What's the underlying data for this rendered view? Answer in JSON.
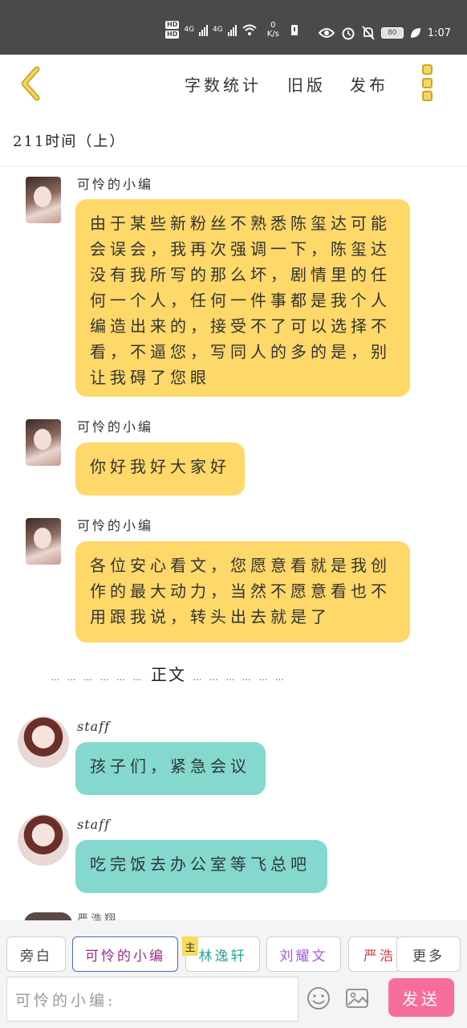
{
  "status_bar": {
    "hd1": "HD",
    "hd2": "HD",
    "net1": "4G",
    "net2": "4G",
    "speed_value": "0",
    "speed_unit": "K/s",
    "battery": "80",
    "time": "1:07"
  },
  "toolbar": {
    "word_count": "字数统计",
    "old_version": "旧版",
    "publish": "发布"
  },
  "chapter_title": "211时间（上）",
  "messages": [
    {
      "name": "可怜的小编",
      "text": "由于某些新粉丝不熟悉陈玺达可能会误会，我再次强调一下，陈玺达没有我所写的那么坏，剧情里的任何一个人，任何一件事都是我个人编造出来的，接受不了可以选择不看，不逼您，写同人的多的是，别让我碍了您眼"
    },
    {
      "name": "可怜的小编",
      "text": "你好我好大家好"
    },
    {
      "name": "可怜的小编",
      "text": "各位安心看文，您愿意看就是我创作的最大动力，当然不愿意看也不用跟我说，转头出去就是了"
    },
    {
      "name": "staff",
      "text": "孩子们，紧急会议"
    },
    {
      "name": "staff",
      "text": "吃完饭去办公室等飞总吧"
    }
  ],
  "separator": {
    "dots_left": "… … … … … …",
    "label": "正文",
    "dots_right": "… … … … … …"
  },
  "partial_name": "严浩翔",
  "roles": {
    "narration": "旁白",
    "active": "可怜的小编",
    "main_tag": "主",
    "r1": "林逸轩",
    "r2": "刘耀文",
    "r3": "严浩",
    "more": "更多"
  },
  "input": {
    "placeholder": "可怜的小编:"
  },
  "send": "发送",
  "colors": {
    "bubble_author": "#fed869",
    "bubble_staff": "#85d8cd",
    "send_button": "#f76d9c",
    "accent_border": "#4a67c7"
  }
}
